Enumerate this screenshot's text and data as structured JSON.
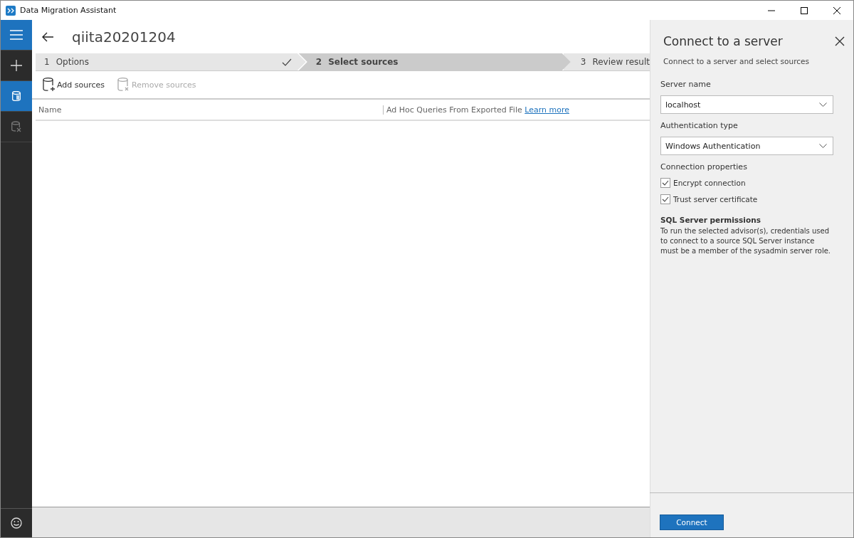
{
  "window": {
    "title": "Data Migration Assistant"
  },
  "nav": [
    {
      "kind": "menu",
      "selected": true
    },
    {
      "kind": "plus",
      "selected": false
    },
    {
      "kind": "database",
      "selected": true
    },
    {
      "kind": "database-x",
      "selected": false
    }
  ],
  "nav_bottom": {
    "kind": "smiley"
  },
  "project": {
    "title": "qiita20201204"
  },
  "steps": [
    {
      "number": "1",
      "label": "Options",
      "selected": false,
      "done": true
    },
    {
      "number": "2",
      "label": "Select sources",
      "selected": true,
      "done": false
    },
    {
      "number": "3",
      "label": "Review result",
      "selected": false,
      "done": false
    }
  ],
  "toolbar": [
    {
      "kind": "add",
      "label": "Add sources",
      "disabled": false
    },
    {
      "kind": "remove",
      "label": "Remove sources",
      "disabled": true
    }
  ],
  "table": {
    "columns": [
      {
        "label": "Name"
      },
      {
        "label": "Ad Hoc Queries From Exported File",
        "link": "Learn more"
      }
    ]
  },
  "panel": {
    "title": "Connect to a server",
    "subtitle": "Connect to a server and select sources",
    "fields": [
      {
        "label": "Server name",
        "value": "localhost"
      },
      {
        "label": "Authentication type",
        "value": "Windows Authentication"
      }
    ],
    "properties_label": "Connection properties",
    "checkboxes": [
      {
        "label": "Encrypt connection",
        "checked": true
      },
      {
        "label": "Trust server certificate",
        "checked": true
      }
    ],
    "permissions_title": "SQL Server permissions",
    "permissions_text": "To run the selected advisor(s), credentials used to connect to a source SQL Server instance must be a member of the sysadmin server role.",
    "button": "Connect"
  }
}
